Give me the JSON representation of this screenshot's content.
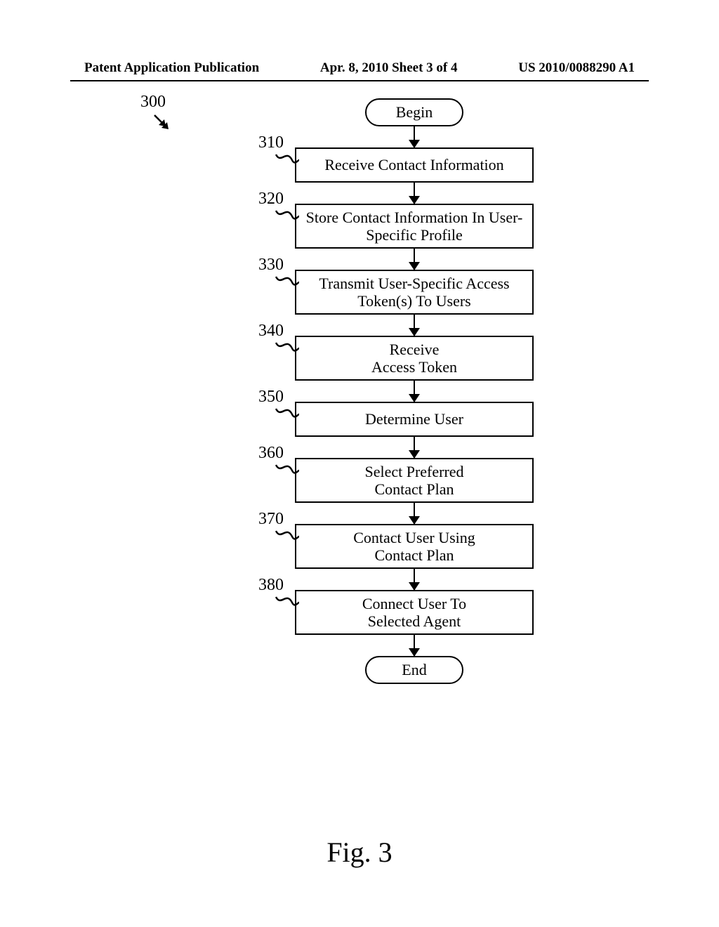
{
  "header": {
    "left": "Patent Application Publication",
    "center": "Apr. 8, 2010   Sheet 3 of 4",
    "right": "US 2010/0088290 A1"
  },
  "figure_ref": "300",
  "terminals": {
    "begin": "Begin",
    "end": "End"
  },
  "steps": [
    {
      "ref": "310",
      "text": "Receive Contact Information"
    },
    {
      "ref": "320",
      "text": "Store Contact Information In User-Specific Profile"
    },
    {
      "ref": "330",
      "text": "Transmit User-Specific Access Token(s) To Users"
    },
    {
      "ref": "340",
      "text": "Receive\nAccess Token"
    },
    {
      "ref": "350",
      "text": "Determine User"
    },
    {
      "ref": "360",
      "text": "Select Preferred\nContact Plan"
    },
    {
      "ref": "370",
      "text": "Contact User Using\nContact Plan"
    },
    {
      "ref": "380",
      "text": "Connect User To\nSelected Agent"
    }
  ],
  "caption": "Fig. 3"
}
